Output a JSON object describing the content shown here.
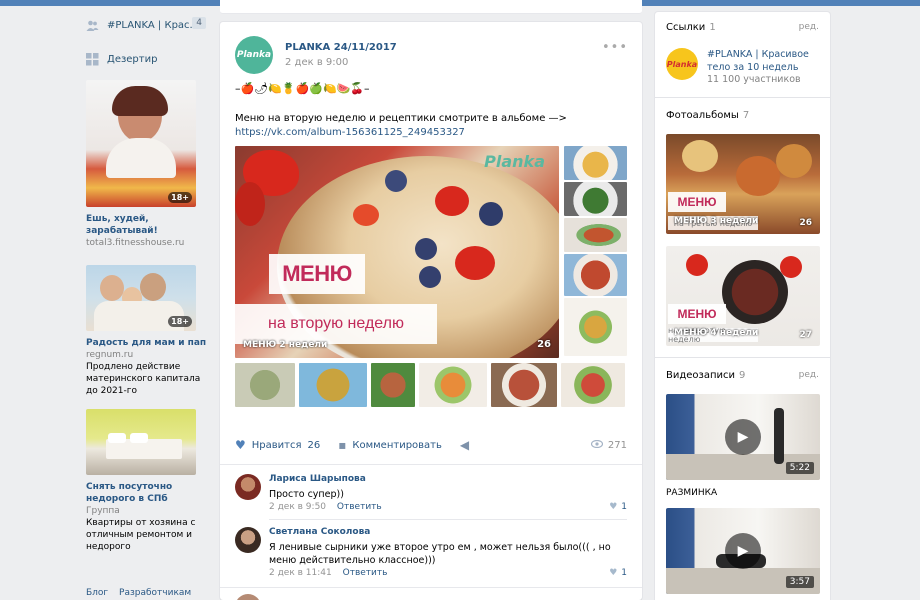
{
  "left": {
    "menu": [
      {
        "label": "#PLANKA | Крас...",
        "badge": "4",
        "icon": "users-icon"
      },
      {
        "label": "Дезертир",
        "icon": "apps-icon"
      }
    ],
    "ads": [
      {
        "title": "Ешь, худей, зарабатывай!",
        "domain": "total3.fitnesshouse.ru",
        "text": "",
        "age": "18+"
      },
      {
        "title": "Радость для мам и пап",
        "domain": "regnum.ru",
        "text": "Продлено действие материнского капитала до 2021-го",
        "age": "18+"
      },
      {
        "title": "Снять посуточно недорого в СПб",
        "domain": "Группа",
        "text": "Квартиры от хозяина с отличным ремонтом и недорого",
        "age": ""
      }
    ],
    "footer": [
      "Блог",
      "Разработчикам"
    ]
  },
  "post": {
    "author": "PLANKA 24/11/2017",
    "date": "2 дек в 9:00",
    "avatar_text": "Planka",
    "emoji_line": "–🍎🌶🍋🍍🍎🍏🍋🍉🍒–",
    "text": "Меню на вторую неделю и рецептики смотрите в альбоме —>",
    "link": "https://vk.com/album-156361125_249453327",
    "photo": {
      "menu_label": "МЕНЮ",
      "week_label": "на вторую неделю",
      "caption": "МЕНЮ 2 недели",
      "count": "26",
      "watermark": "Planka"
    },
    "actions": {
      "like_label": "Нравится",
      "like_count": "26",
      "comment_label": "Комментировать",
      "views": "271"
    },
    "comments": [
      {
        "author": "Лариса Шарыпова",
        "text": "Просто супер))",
        "date": "2 дек в 9:50",
        "reply": "Ответить",
        "likes": "1"
      },
      {
        "author": "Светлана Соколова",
        "text": "Я ленивые сырники уже второе утро ем , может нельзя было((( , но меню действительно классное)))",
        "date": "2 дек в 11:41",
        "reply": "Ответить",
        "likes": "1"
      }
    ]
  },
  "right": {
    "links": {
      "title": "Ссылки",
      "count": "1",
      "edit": "ред.",
      "item_title": "#PLANKA | Красивое тело за 10 недель",
      "item_sub": "11 100 участников",
      "avatar_text": "Planka"
    },
    "albums": {
      "title": "Фотоальбомы",
      "count": "7",
      "items": [
        {
          "menu": "МЕНЮ",
          "title": "МЕНЮ 3 недели",
          "sub": "на третью неделю",
          "count": "26"
        },
        {
          "menu": "МЕНЮ",
          "title": "МЕНЮ 4 недели",
          "sub": "на четвертую неделю",
          "count": "27"
        }
      ]
    },
    "videos": {
      "title": "Видеозаписи",
      "count": "9",
      "edit": "ред.",
      "items": [
        {
          "duration": "5:22",
          "caption": "РАЗМИНКА"
        },
        {
          "duration": "3:57",
          "caption": ""
        }
      ]
    }
  }
}
